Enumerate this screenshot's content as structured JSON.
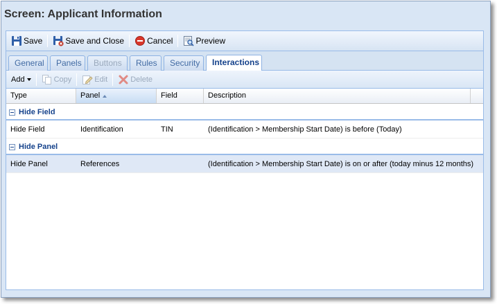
{
  "screen": {
    "title": "Screen: Applicant Information"
  },
  "toolbar": {
    "save": "Save",
    "save_close": "Save and Close",
    "cancel": "Cancel",
    "preview": "Preview"
  },
  "tabs": [
    {
      "label": "General",
      "state": "normal"
    },
    {
      "label": "Panels",
      "state": "normal"
    },
    {
      "label": "Buttons",
      "state": "disabled"
    },
    {
      "label": "Rules",
      "state": "normal"
    },
    {
      "label": "Security",
      "state": "normal"
    },
    {
      "label": "Interactions",
      "state": "active"
    }
  ],
  "subtoolbar": {
    "add": "Add",
    "copy": "Copy",
    "edit": "Edit",
    "delete": "Delete"
  },
  "grid": {
    "columns": [
      "Type",
      "Panel",
      "Field",
      "Description"
    ],
    "sorted_column": "Panel",
    "groups": [
      {
        "label": "Hide Field",
        "rows": [
          {
            "type": "Hide Field",
            "panel": "Identification",
            "field": "TIN",
            "description": "(Identification > Membership Start Date) is before (Today)",
            "selected": false
          }
        ]
      },
      {
        "label": "Hide Panel",
        "rows": [
          {
            "type": "Hide Panel",
            "panel": "References",
            "field": "",
            "description": "(Identification > Membership Start Date) is on or after (today minus 12 months)",
            "selected": true
          }
        ]
      }
    ]
  },
  "colors": {
    "accent": "#15428b",
    "tab_border": "#8db2e3",
    "selected_row": "#dfe8f6",
    "panel_bg": "#d9e6f5"
  }
}
